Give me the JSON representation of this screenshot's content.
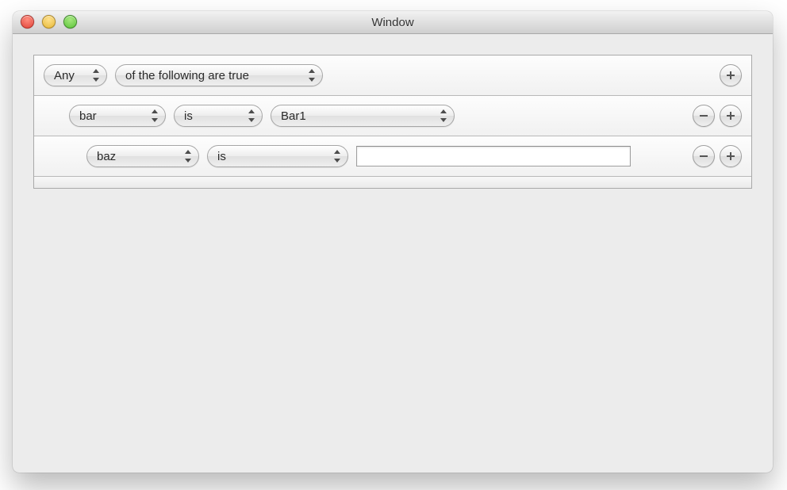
{
  "window": {
    "title": "Window"
  },
  "rows": [
    {
      "match": "Any",
      "clause": "of the following are true"
    },
    {
      "field": "bar",
      "op": "is",
      "value": "Bar1"
    },
    {
      "field": "baz",
      "op": "is",
      "value": ""
    }
  ]
}
